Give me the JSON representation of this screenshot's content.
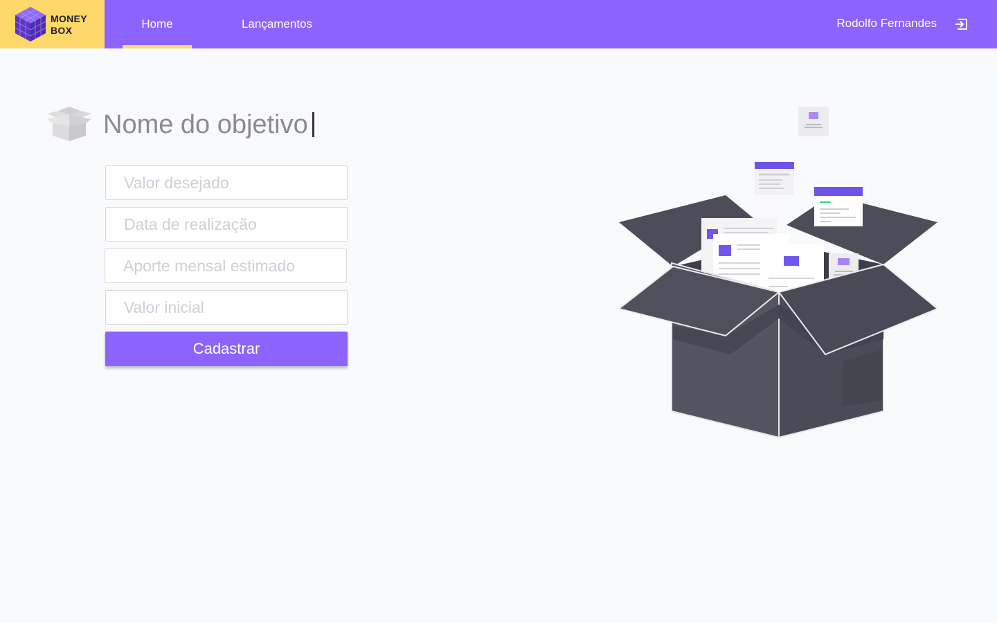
{
  "brand": {
    "line1": "MONEY",
    "line2": "BOX",
    "logo_icon": "cube-logo-icon",
    "colors": {
      "logo_bg": "#fed86b",
      "topbar": "#8c63fd"
    }
  },
  "nav": {
    "tabs": [
      {
        "label": "Home",
        "active": true
      },
      {
        "label": "Lançamentos",
        "active": false
      }
    ]
  },
  "user": {
    "name": "Rodolfo Fernandes",
    "logout_icon": "logout-icon"
  },
  "form": {
    "title_value": "Nome do objetivo",
    "title_icon": "open-box-icon",
    "fields": [
      {
        "placeholder": "Valor desejado",
        "value": ""
      },
      {
        "placeholder": "Data de realização",
        "value": ""
      },
      {
        "placeholder": "Aporte mensal estimado",
        "value": ""
      },
      {
        "placeholder": "Valor inicial",
        "value": ""
      }
    ],
    "submit_label": "Cadastrar",
    "colors": {
      "accent": "#8c63fd"
    }
  },
  "illustration": {
    "icon": "open-box-documents-illustration"
  }
}
